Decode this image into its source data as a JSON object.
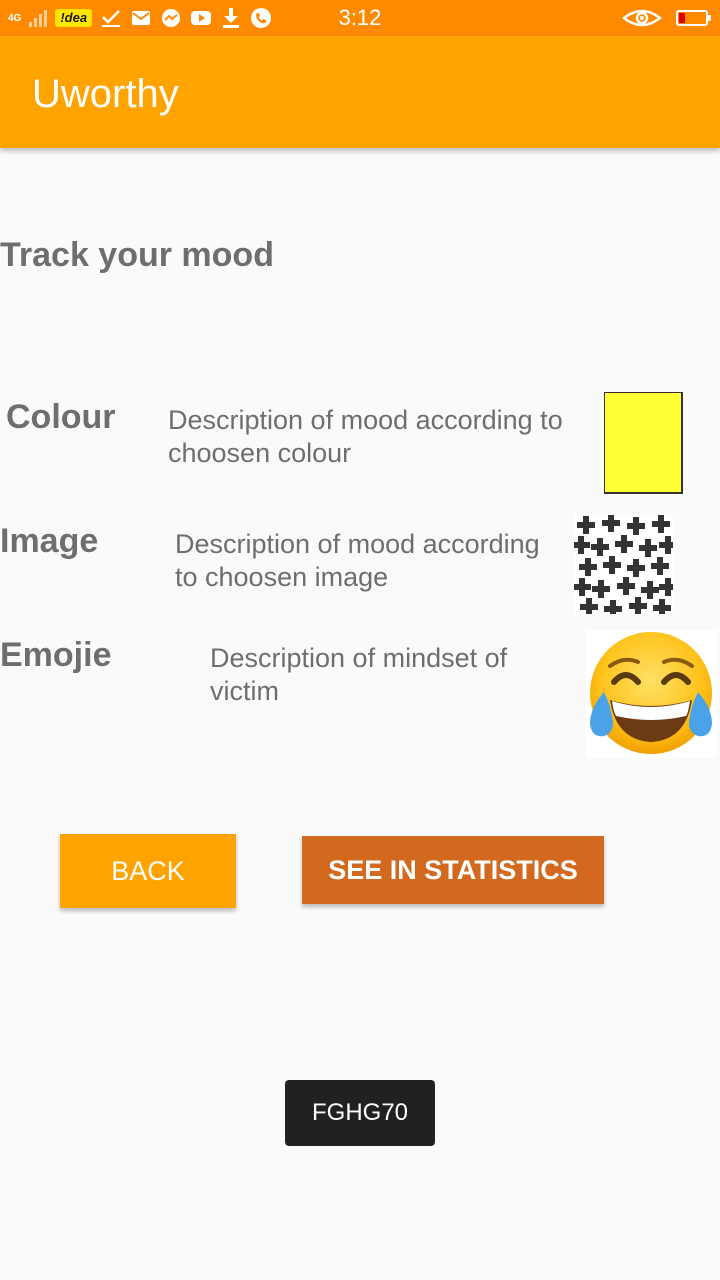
{
  "status_bar": {
    "network": "4G",
    "carrier": "!dea",
    "time": "3:12",
    "icons": [
      "signal-icon",
      "check-icon",
      "gmail-icon",
      "messenger-icon",
      "youtube-icon",
      "download-icon",
      "phone-icon",
      "eye-icon",
      "battery-icon"
    ],
    "battery_level": 0.15,
    "background_color": "#ff8a00"
  },
  "app_bar": {
    "title": "Uworthy",
    "background_color": "#ffa300"
  },
  "main": {
    "heading": "Track your mood",
    "rows": [
      {
        "label": "Colour",
        "description": "Description of mood according to choosen colour",
        "visual": "yellow-swatch",
        "color": "#ffff33"
      },
      {
        "label": "Image",
        "description": "Description of mood according to choosen image",
        "visual": "pattern-image"
      },
      {
        "label": "Emojie",
        "description": "Description of mindset of victim",
        "visual": "tears-of-joy-emoji"
      }
    ]
  },
  "buttons": {
    "back_label": "BACK",
    "stats_label": "SEE IN STATISTICS",
    "back_color": "#ffa300",
    "stats_color": "#d2691e"
  },
  "toast": {
    "text": "FGHG70"
  }
}
